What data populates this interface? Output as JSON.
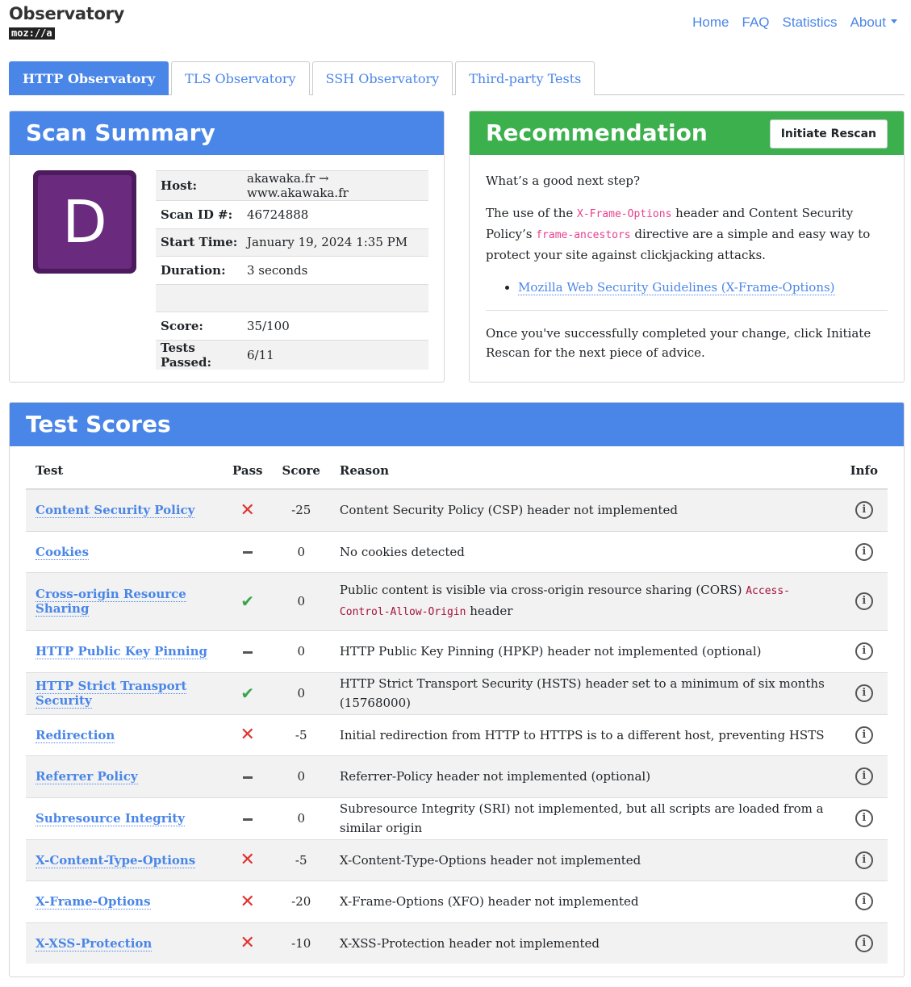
{
  "brand": {
    "title": "Observatory",
    "sub": "moz://a"
  },
  "nav": {
    "home": "Home",
    "faq": "FAQ",
    "statistics": "Statistics",
    "about": "About"
  },
  "tabs": [
    "HTTP Observatory",
    "TLS Observatory",
    "SSH Observatory",
    "Third-party Tests"
  ],
  "summary": {
    "title": "Scan Summary",
    "grade": "D",
    "rows": [
      {
        "k": "Host:",
        "v": "akawaka.fr → www.akawaka.fr"
      },
      {
        "k": "Scan ID #:",
        "v": "46724888"
      },
      {
        "k": "Start Time:",
        "v": "January 19, 2024 1:35 PM"
      },
      {
        "k": "Duration:",
        "v": "3 seconds"
      },
      {
        "k": "",
        "v": ""
      },
      {
        "k": "Score:",
        "v": "35/100"
      },
      {
        "k": "Tests Passed:",
        "v": "6/11"
      }
    ]
  },
  "recommendation": {
    "title": "Recommendation",
    "rescan": "Initiate Rescan",
    "q": "What’s a good next step?",
    "p1a": "The use of the ",
    "code1": "X-Frame-Options",
    "p1b": " header and Content Security Policy’s ",
    "code2": "frame-ancestors",
    "p1c": " directive are a simple and easy way to protect your site against clickjacking attacks.",
    "link": "Mozilla Web Security Guidelines (X-Frame-Options)",
    "p2": "Once you've successfully completed your change, click Initiate Rescan for the next piece of advice."
  },
  "scores": {
    "title": "Test Scores",
    "headers": {
      "test": "Test",
      "pass": "Pass",
      "score": "Score",
      "reason": "Reason",
      "info": "Info"
    },
    "rows": [
      {
        "test": "Content Security Policy",
        "pass": "fail",
        "score": "-25",
        "reason": "Content Security Policy (CSP) header not implemented"
      },
      {
        "test": "Cookies",
        "pass": "na",
        "score": "0",
        "reason": "No cookies detected"
      },
      {
        "test": "Cross-origin Resource Sharing",
        "pass": "pass",
        "score": "0",
        "reason": "Public content is visible via cross-origin resource sharing (CORS) ",
        "code": "Access-Control-Allow-Origin",
        "reason_tail": " header"
      },
      {
        "test": "HTTP Public Key Pinning",
        "pass": "na",
        "score": "0",
        "reason": "HTTP Public Key Pinning (HPKP) header not implemented (optional)"
      },
      {
        "test": "HTTP Strict Transport Security",
        "pass": "pass",
        "score": "0",
        "reason": "HTTP Strict Transport Security (HSTS) header set to a minimum of six months (15768000)"
      },
      {
        "test": "Redirection",
        "pass": "fail",
        "score": "-5",
        "reason": "Initial redirection from HTTP to HTTPS is to a different host, preventing HSTS"
      },
      {
        "test": "Referrer Policy",
        "pass": "na",
        "score": "0",
        "reason": "Referrer-Policy header not implemented (optional)"
      },
      {
        "test": "Subresource Integrity",
        "pass": "na",
        "score": "0",
        "reason": "Subresource Integrity (SRI) not implemented, but all scripts are loaded from a similar origin"
      },
      {
        "test": "X-Content-Type-Options",
        "pass": "fail",
        "score": "-5",
        "reason": "X-Content-Type-Options header not implemented"
      },
      {
        "test": "X-Frame-Options",
        "pass": "fail",
        "score": "-20",
        "reason": "X-Frame-Options (XFO) header not implemented"
      },
      {
        "test": "X-XSS-Protection",
        "pass": "fail",
        "score": "-10",
        "reason": "X-XSS-Protection header not implemented"
      }
    ]
  },
  "colors": {
    "accent": "#4a86e8",
    "recommend": "#3cb04c",
    "grade": "#6a2a7d",
    "fail": "#e0322f",
    "pass": "#3ca34b"
  }
}
